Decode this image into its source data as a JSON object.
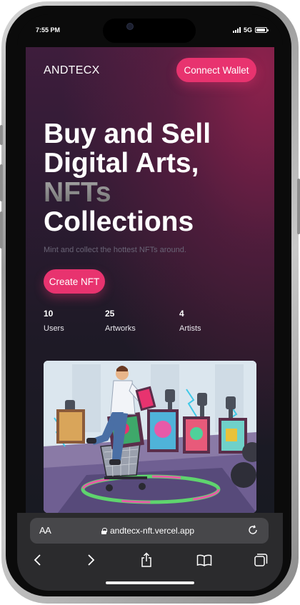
{
  "status_bar": {
    "time": "7:55 PM",
    "network": "5G",
    "battery_level": 0.9
  },
  "header": {
    "logo": "ANDTECX",
    "connect_button": "Connect Wallet"
  },
  "hero": {
    "title_lines": [
      "Buy and Sell",
      "Digital Arts,",
      "NFTs",
      "Collections"
    ],
    "subtitle": "Mint and collect the hottest NFTs around.",
    "create_button": "Create NFT"
  },
  "stats": [
    {
      "value": "10",
      "label": "Users"
    },
    {
      "value": "25",
      "label": "Artworks"
    },
    {
      "value": "4",
      "label": "Artists"
    }
  ],
  "safari": {
    "aa_label": "AA",
    "url": "andtecx-nft.vercel.app"
  },
  "icons": {
    "reload": "reload-icon",
    "back": "chevron-left-icon",
    "forward": "chevron-right-icon",
    "share": "share-icon",
    "bookmarks": "book-icon",
    "tabs": "tabs-icon",
    "lock": "lock-icon"
  },
  "colors": {
    "accent": "#e8336f",
    "page_bg_top": "#3e1d3c",
    "page_bg_bottom": "#181a22",
    "safari_bar": "#2b2b2d"
  }
}
